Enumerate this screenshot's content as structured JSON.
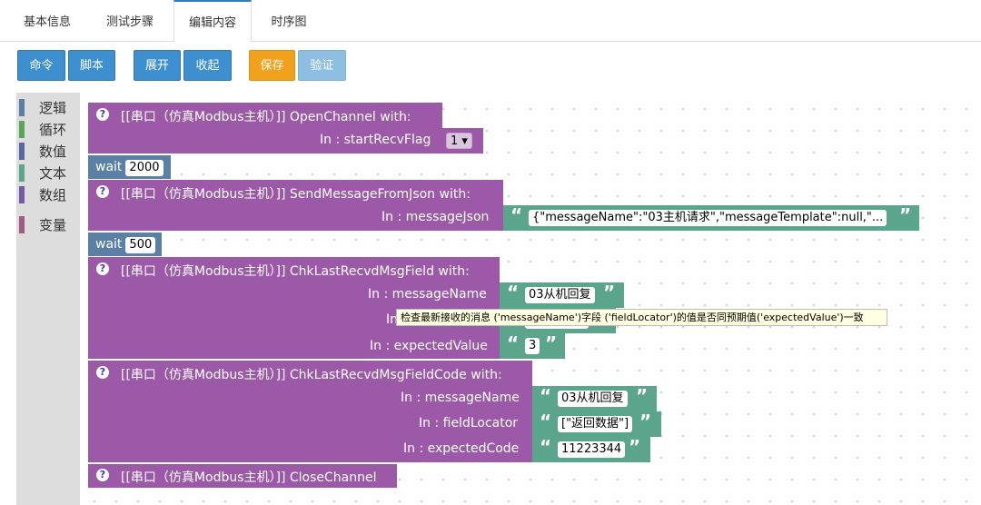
{
  "tabs": [
    "基本信息",
    "测试步骤",
    "编辑内容",
    "时序图"
  ],
  "toolbar": {
    "cmd": "命令",
    "script": "脚本",
    "expand": "展开",
    "collapse": "收起",
    "save": "保存",
    "verify": "验证"
  },
  "categories": [
    {
      "label": "逻辑",
      "color": "#5b80a5"
    },
    {
      "label": "循环",
      "color": "#5ba55b"
    },
    {
      "label": "数值",
      "color": "#5b67a5"
    },
    {
      "label": "文本",
      "color": "#5ba58c"
    },
    {
      "label": "数组",
      "color": "#745ba5"
    },
    {
      "label": "变量",
      "color": "#a55b80"
    }
  ],
  "blocks": {
    "b1": {
      "title": "[[串口（仿真Modbus主机）]]  OpenChannel  with:",
      "param": "In : startRecvFlag",
      "value": "1 ▾"
    },
    "wait1": {
      "label": "wait",
      "value": "2000"
    },
    "b2": {
      "title": "[[串口（仿真Modbus主机）]]  SendMessageFromJson  with:",
      "param": "In : messageJson",
      "value": "{\"messageName\":\"03主机请求\",\"messageTemplate\":null,\"..."
    },
    "wait2": {
      "label": "wait",
      "value": "500"
    },
    "b3": {
      "title": "[[串口（仿真Modbus主机）]]  ChkLastRecvdMsgField  with:",
      "p1": "In : messageName",
      "v1": "03从机回复",
      "p2": "In",
      "v2": "[返回数据]",
      "p3": "In : expectedValue",
      "v3": "3"
    },
    "b4": {
      "title": "[[串口（仿真Modbus主机）]]  ChkLastRecvdMsgFieldCode  with:",
      "p1": "In : messageName",
      "v1": "03从机回复",
      "p2": "In : fieldLocator",
      "v2": "[\"返回数据\"]",
      "p3": "In : expectedCode",
      "v3": "11223344"
    },
    "b5": {
      "title": "[[串口（仿真Modbus主机）]]  CloseChannel"
    }
  },
  "help_glyph": "?",
  "quote_open": "“",
  "quote_close": "”",
  "tooltip": "检查最新接收的消息 ('messageName')字段 ('fieldLocator')的值是否同预期值('expectedValue')一致"
}
